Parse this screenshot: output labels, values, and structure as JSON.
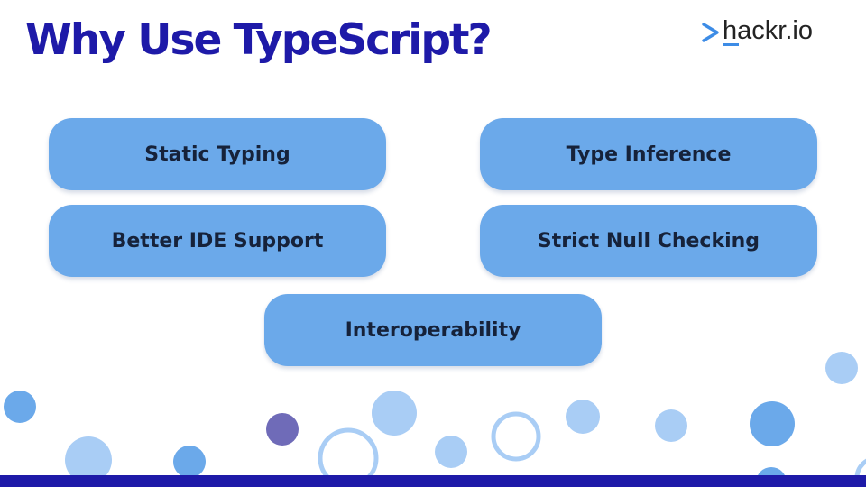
{
  "title": "Why Use TypeScript?",
  "logo": {
    "text": "hackr.io",
    "chevron_icon": "chevron-right-icon"
  },
  "features": [
    {
      "label": "Static Typing"
    },
    {
      "label": "Type Inference"
    },
    {
      "label": "Better IDE Support"
    },
    {
      "label": "Strict Null Checking"
    },
    {
      "label": "Interoperability"
    }
  ],
  "colors": {
    "title": "#1e1aa8",
    "pill_fill": "#6ba9ea",
    "pill_text": "#16223a",
    "bubble_light": "#a9cdf5",
    "bubble_mid": "#6ba9ea",
    "bubble_dark": "#6f6bb8",
    "bottom_bar": "#1e1aa8",
    "logo_accent": "#3d8ce6"
  }
}
